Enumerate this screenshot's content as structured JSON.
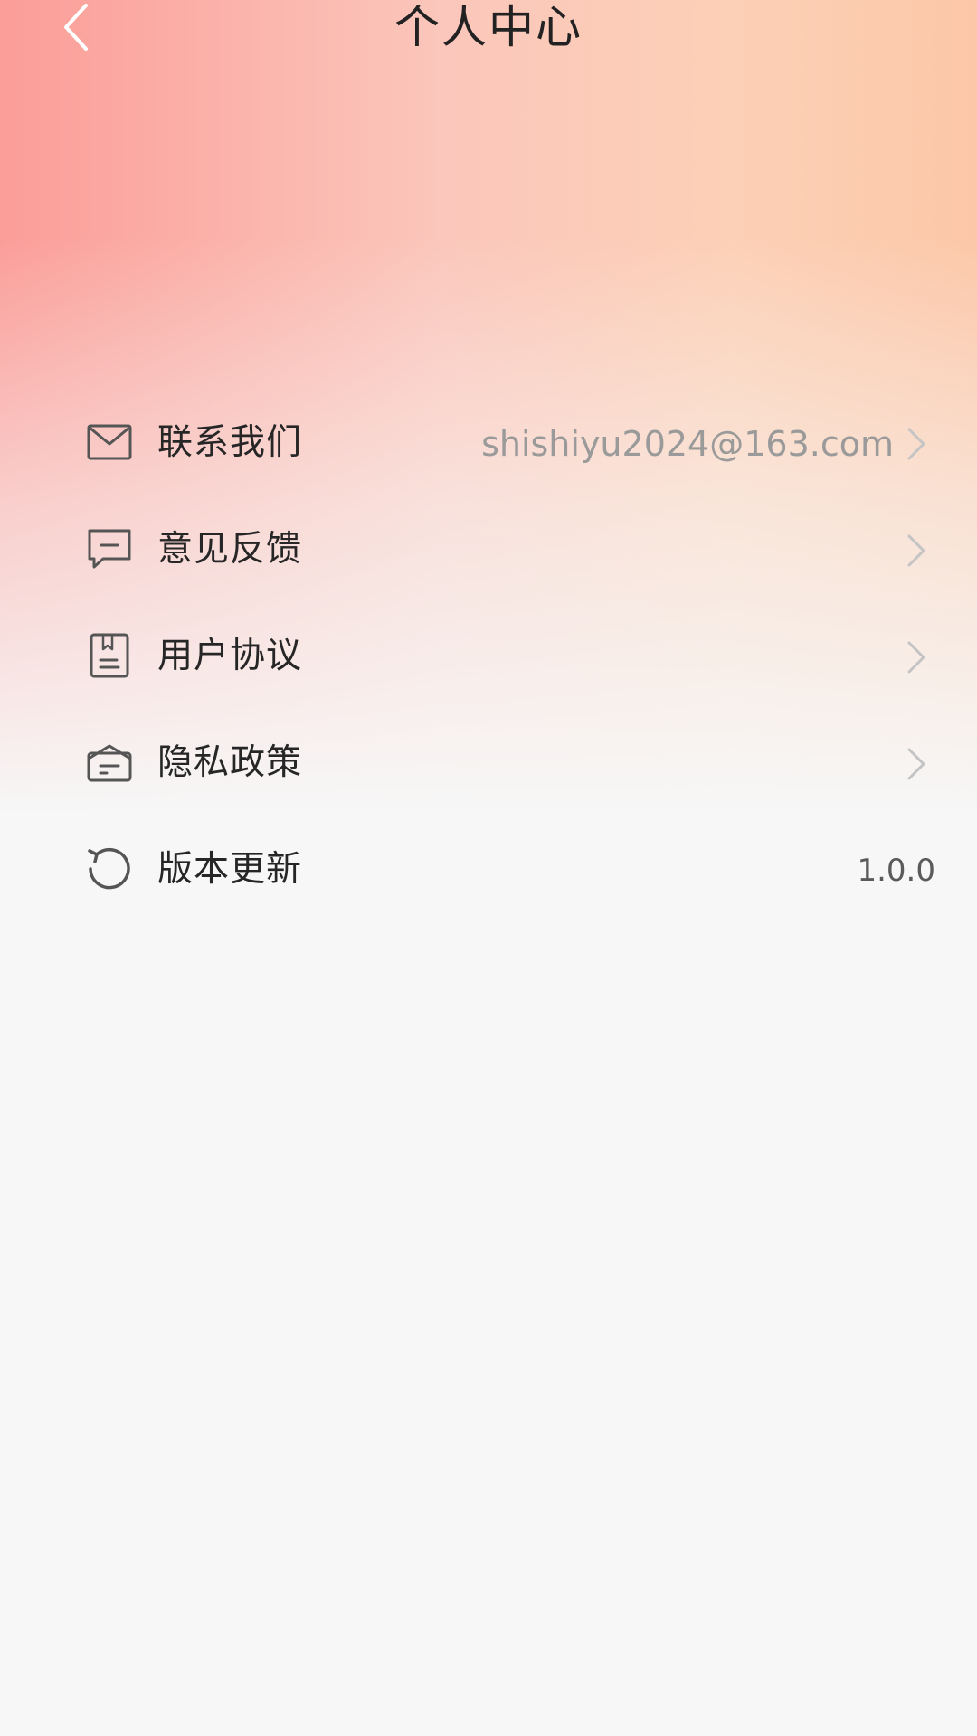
{
  "header": {
    "title": "个人中心",
    "back_icon": "back-arrow-icon"
  },
  "menu": {
    "items": [
      {
        "label": "联系我们",
        "value": "shishiyu2024@163.com",
        "icon": "mail-icon",
        "has_chevron": true
      },
      {
        "label": "意见反馈",
        "value": "",
        "icon": "feedback-icon",
        "has_chevron": true
      },
      {
        "label": "用户协议",
        "value": "",
        "icon": "agreement-icon",
        "has_chevron": true
      },
      {
        "label": "隐私政策",
        "value": "",
        "icon": "privacy-icon",
        "has_chevron": true
      },
      {
        "label": "版本更新",
        "value": "1.0.0",
        "icon": "refresh-icon",
        "has_chevron": false
      }
    ]
  },
  "colors": {
    "gradient_left": "#fb9d98",
    "gradient_right": "#fcc7a8",
    "background": "#f7f7f7",
    "text_primary": "#262626",
    "text_secondary": "#9a9a9a"
  }
}
